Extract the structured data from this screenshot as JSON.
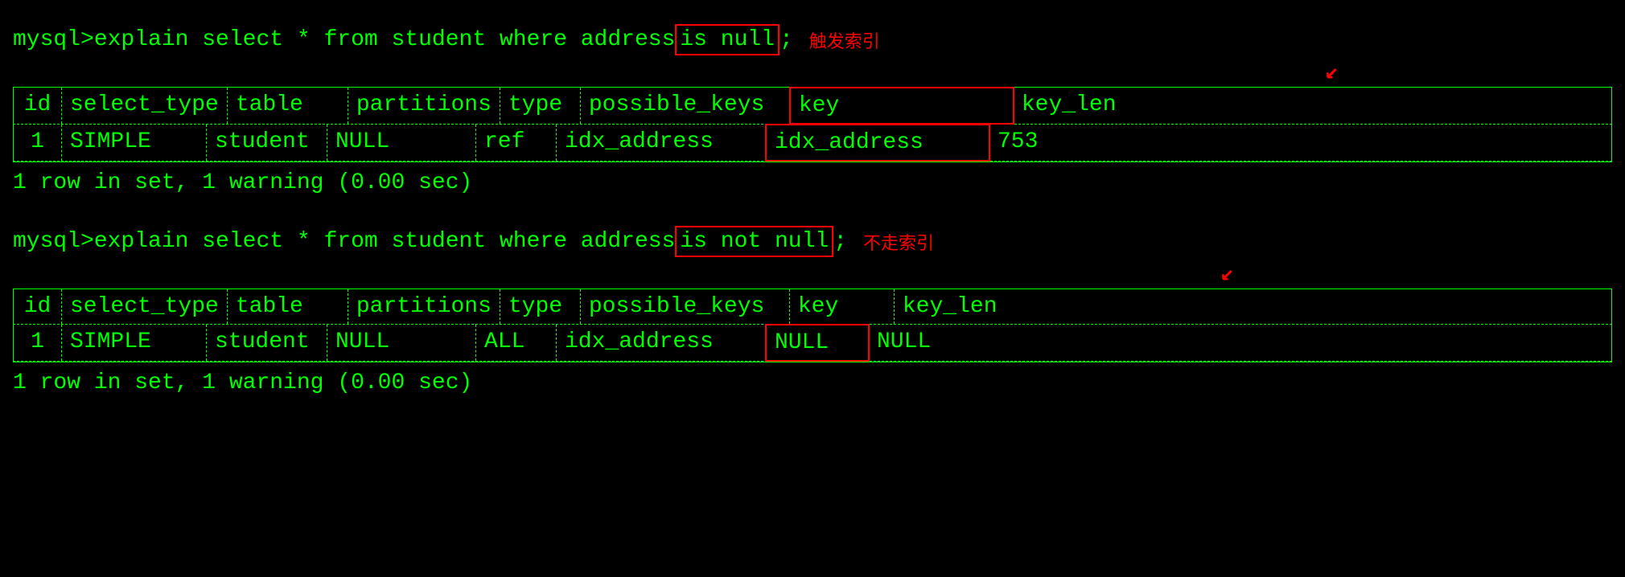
{
  "bg_color": "#000000",
  "text_color": "#00ff00",
  "accent_color": "#ff0000",
  "query1": {
    "prompt": "mysql>",
    "command": " explain select * from student where address ",
    "highlight": "is null",
    "semicolon": ";",
    "annotation": "触发索引",
    "table": {
      "headers": [
        "id",
        "select_type",
        "table",
        "partitions",
        "type",
        "possible_keys",
        "key",
        "key_len"
      ],
      "rows": [
        [
          "1",
          "SIMPLE",
          "student",
          "NULL",
          "ref",
          "idx_address",
          "idx_address",
          "753"
        ]
      ]
    },
    "result": "1 row in set, 1 warning (0.00 sec)"
  },
  "query2": {
    "prompt": "mysql>",
    "command": " explain select * from student where address ",
    "highlight": "is not null",
    "semicolon": ";",
    "annotation": "不走索引",
    "table": {
      "headers": [
        "id",
        "select_type",
        "table",
        "partitions",
        "type",
        "possible_keys",
        "key",
        "key_len"
      ],
      "rows": [
        [
          "1",
          "SIMPLE",
          "student",
          "NULL",
          "ALL",
          "idx_address",
          "NULL",
          "NULL"
        ]
      ]
    },
    "result": "1 row in set, 1 warning (0.00 sec)"
  }
}
